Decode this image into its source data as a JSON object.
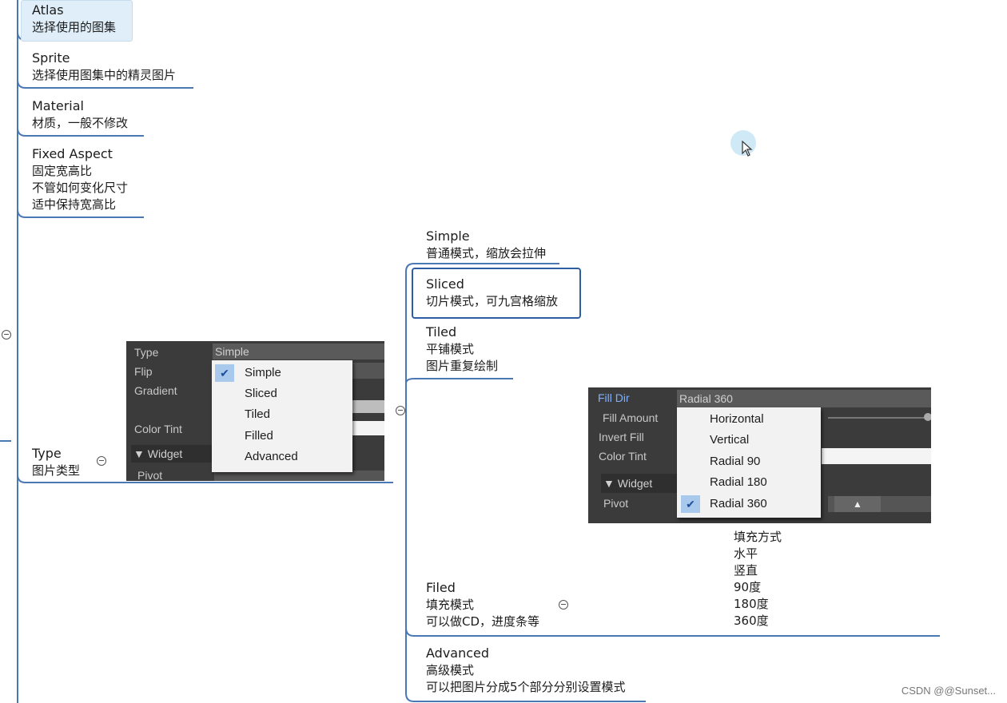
{
  "left_nodes": {
    "atlas": {
      "title": "Atlas",
      "desc": [
        "选择使用的图集"
      ]
    },
    "sprite": {
      "title": "Sprite",
      "desc": [
        "选择使用图集中的精灵图片"
      ]
    },
    "material": {
      "title": "Material",
      "desc": [
        "材质，一般不修改"
      ]
    },
    "fixed_aspect": {
      "title": "Fixed Aspect",
      "desc": [
        "固定宽高比",
        "不管如何变化尺寸",
        "适中保持宽高比"
      ]
    },
    "type": {
      "title": "Type",
      "desc": [
        "图片类型"
      ]
    }
  },
  "type_children": {
    "simple": {
      "title": "Simple",
      "desc": [
        "普通模式，缩放会拉伸"
      ]
    },
    "sliced": {
      "title": "Sliced",
      "desc": [
        "切片模式，可九宫格缩放"
      ]
    },
    "tiled": {
      "title": "Tiled",
      "desc": [
        "平铺模式",
        "图片重复绘制"
      ]
    },
    "filed": {
      "title": "Filed",
      "desc": [
        "填充模式",
        "可以做CD，进度条等"
      ]
    },
    "advanced": {
      "title": "Advanced",
      "desc": [
        "高级模式",
        "可以把图片分成5个部分分别设置模式"
      ]
    }
  },
  "fill_note": [
    "填充方式",
    "水平",
    "竖直",
    "90度",
    "180度",
    "360度"
  ],
  "type_screenshot": {
    "labels": [
      "Type",
      "Flip",
      "Gradient",
      "Color Tint",
      "▼ Widget",
      "Pivot"
    ],
    "type_value": "Simple",
    "options": [
      "Simple",
      "Sliced",
      "Tiled",
      "Filled",
      "Advanced"
    ],
    "selected_index": 0
  },
  "fill_screenshot": {
    "labels": [
      "Fill Dir",
      "Fill Amount",
      "Invert Fill",
      "Color Tint",
      "▼ Widget",
      "Pivot"
    ],
    "fill_dir_value": "Radial 360",
    "options": [
      "Horizontal",
      "Vertical",
      "Radial 90",
      "Radial 180",
      "Radial 360"
    ],
    "selected_index": 4
  },
  "watermark": "CSDN @@Sunset...",
  "colors": {
    "branch_line": "#3a6fb0",
    "node_highlight": "#dfeef8",
    "selected_border": "#2f5da3",
    "checkmark_bg": "#a8c8ec"
  }
}
